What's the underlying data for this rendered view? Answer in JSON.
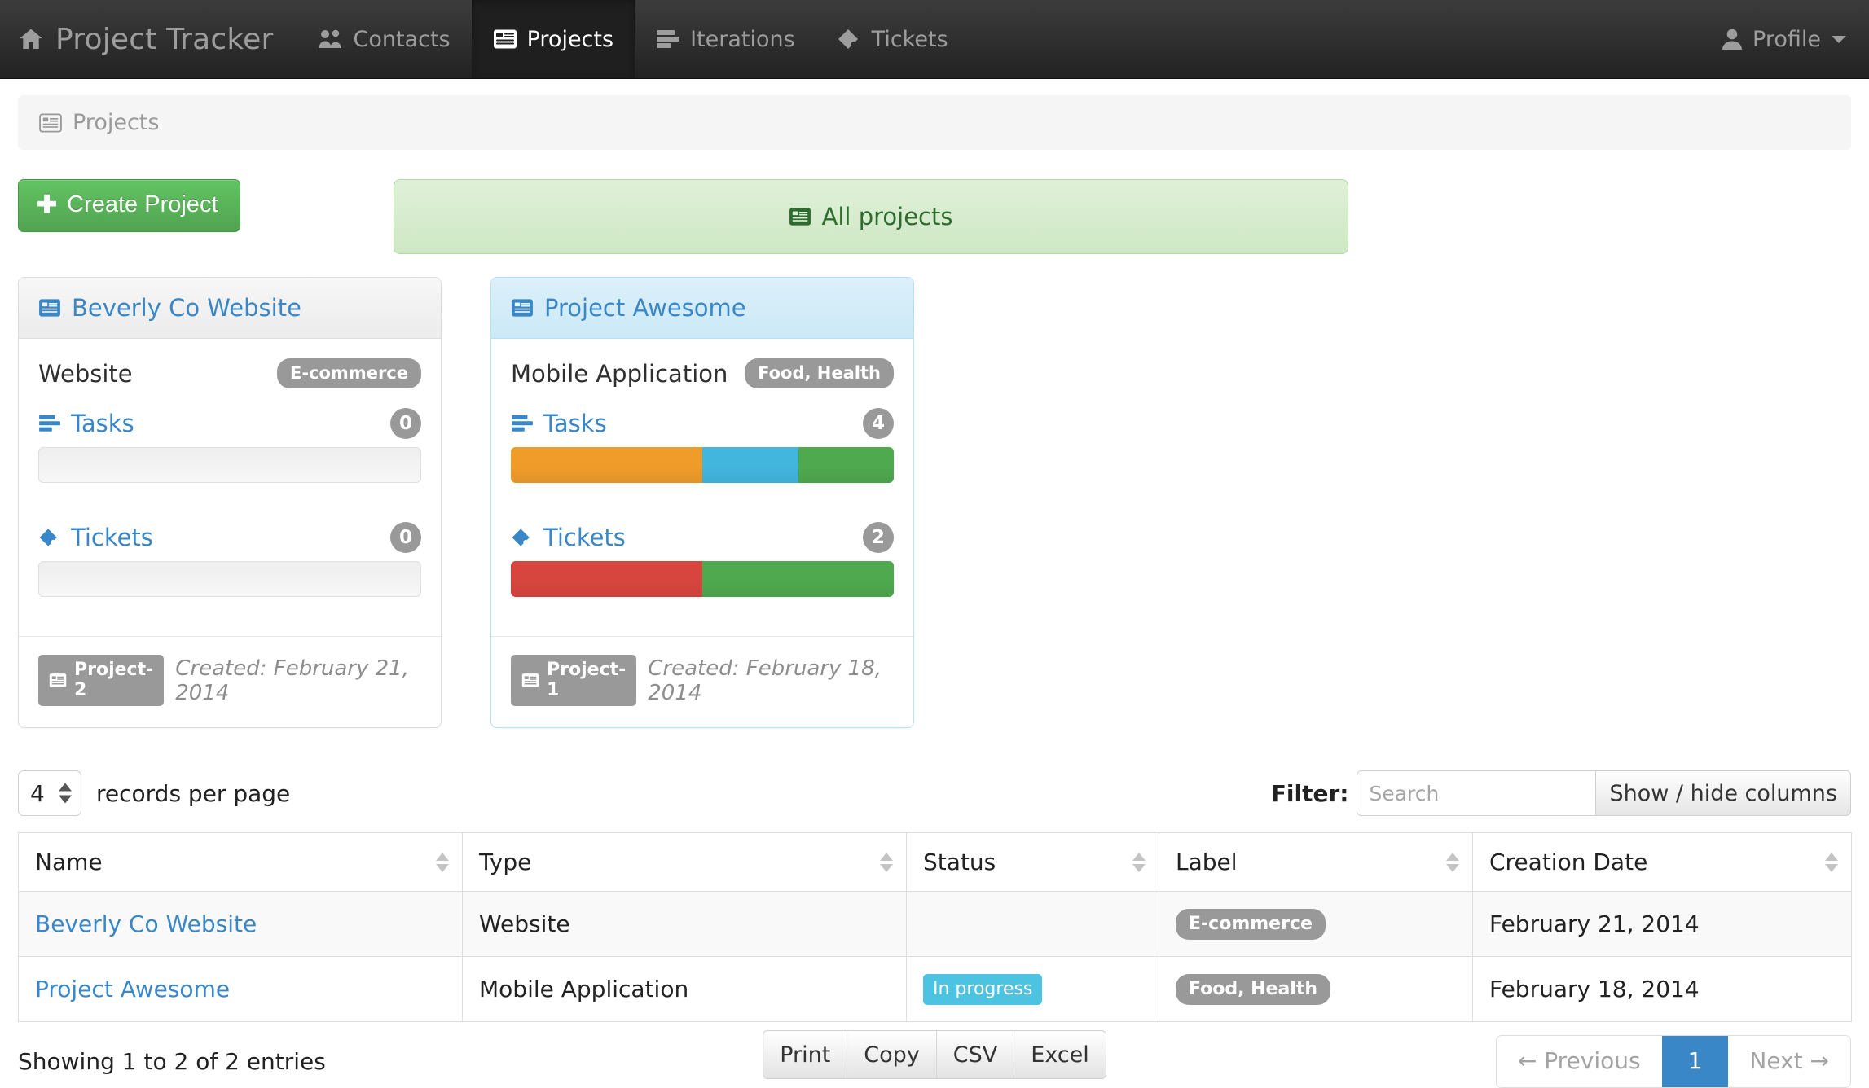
{
  "navbar": {
    "brand": "Project Tracker",
    "brand_icon": "home-icon",
    "items": [
      {
        "label": "Contacts",
        "icon": "users-icon",
        "active": false
      },
      {
        "label": "Projects",
        "icon": "list-alt-icon",
        "active": true
      },
      {
        "label": "Iterations",
        "icon": "tasks-icon",
        "active": false
      },
      {
        "label": "Tickets",
        "icon": "ticket-icon",
        "active": false
      }
    ],
    "profile": {
      "label": "Profile",
      "icon": "user-icon"
    }
  },
  "breadcrumb": {
    "label": "Projects",
    "icon": "list-alt-icon"
  },
  "toolbar": {
    "create_label": "Create Project",
    "all_projects_label": "All projects"
  },
  "cards": [
    {
      "title": "Beverly Co Website",
      "selected": false,
      "type": "Website",
      "label_pill": "E-commerce",
      "tasks_label": "Tasks",
      "tasks_count": "0",
      "tasks_segments": [],
      "tickets_label": "Tickets",
      "tickets_count": "0",
      "tickets_segments": [],
      "project_tag": "Project-2",
      "created": "Created: February 21, 2014"
    },
    {
      "title": "Project Awesome",
      "selected": true,
      "type": "Mobile Application",
      "label_pill": "Food, Health",
      "tasks_label": "Tasks",
      "tasks_count": "4",
      "tasks_segments": [
        {
          "color": "#ef9c2b",
          "pct": 50
        },
        {
          "color": "#43b6dd",
          "pct": 25
        },
        {
          "color": "#4fa94f",
          "pct": 25
        }
      ],
      "tickets_label": "Tickets",
      "tickets_count": "2",
      "tickets_segments": [
        {
          "color": "#d8453f",
          "pct": 50
        },
        {
          "color": "#4fa94f",
          "pct": 50
        }
      ],
      "project_tag": "Project-1",
      "created": "Created: February 18, 2014"
    }
  ],
  "table_controls": {
    "page_length_value": "4",
    "page_length_suffix": "records per page",
    "filter_label": "Filter:",
    "search_placeholder": "Search",
    "search_value": "",
    "show_hide_columns": "Show / hide columns"
  },
  "table": {
    "columns": [
      "Name",
      "Type",
      "Status",
      "Label",
      "Creation Date"
    ],
    "rows": [
      {
        "name": "Beverly Co Website",
        "type": "Website",
        "status": "",
        "label": "E-commerce",
        "creation_date": "February 21, 2014"
      },
      {
        "name": "Project Awesome",
        "type": "Mobile Application",
        "status": "In progress",
        "label": "Food, Health",
        "creation_date": "February 18, 2014"
      }
    ]
  },
  "footer": {
    "info": "Showing 1 to 2 of 2 entries",
    "exports": [
      "Print",
      "Copy",
      "CSV",
      "Excel"
    ],
    "pagination": {
      "previous": "← Previous",
      "pages": [
        "1"
      ],
      "next": "Next →"
    }
  },
  "colors": {
    "link": "#3a87c8",
    "primary": "#3a87c8",
    "success": "#51a351",
    "info": "#4cc3e0",
    "warning": "#ef9c2b",
    "danger": "#d8453f",
    "muted": "#999999"
  }
}
